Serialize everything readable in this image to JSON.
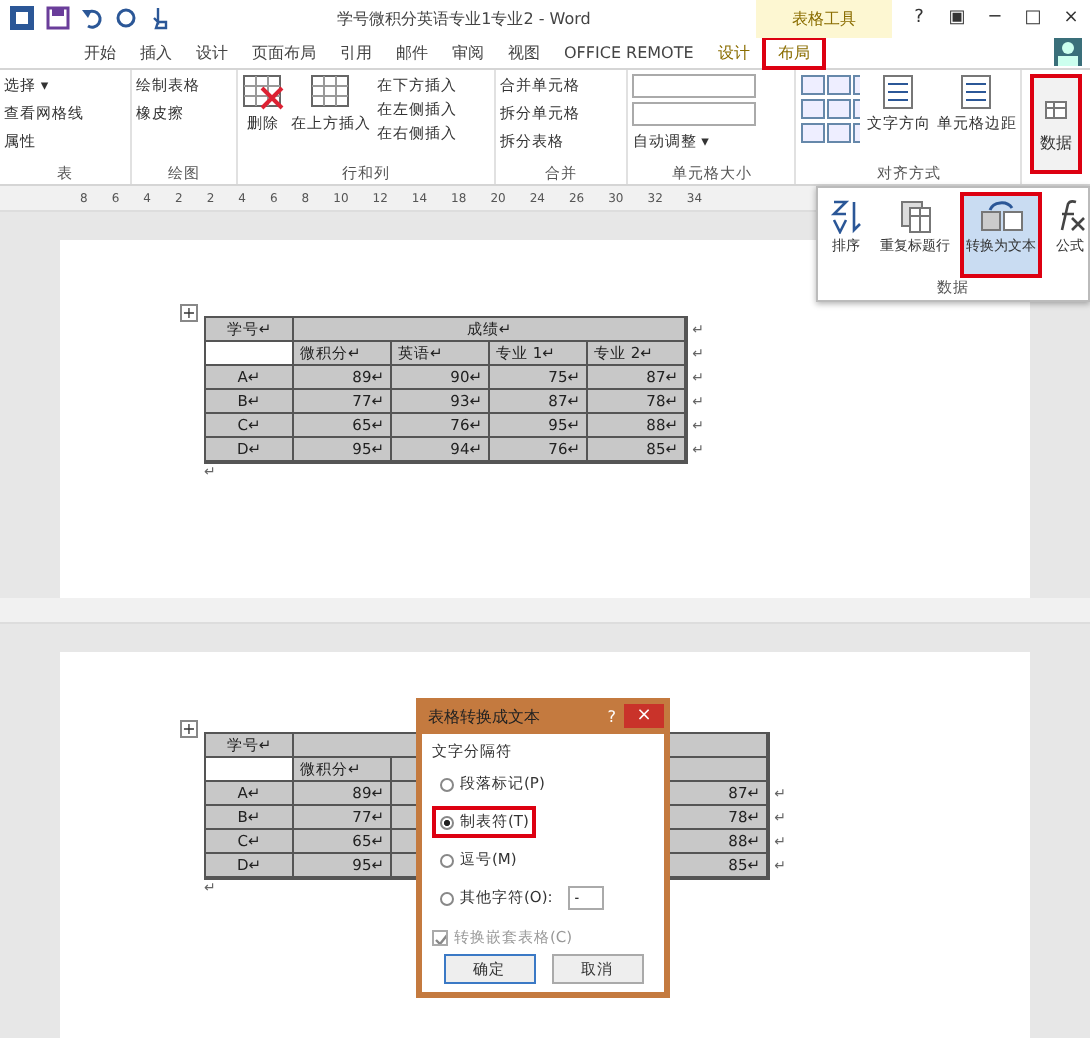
{
  "window": {
    "title": "学号微积分英语专业1专业2 - Word",
    "context_tab_group": "表格工具",
    "controls": [
      "?",
      "▣",
      "─",
      "□",
      "×"
    ]
  },
  "tabs": [
    {
      "label": "开始",
      "selected": false
    },
    {
      "label": "插入",
      "selected": false
    },
    {
      "label": "设计",
      "selected": false
    },
    {
      "label": "页面布局",
      "selected": false
    },
    {
      "label": "引用",
      "selected": false
    },
    {
      "label": "邮件",
      "selected": false
    },
    {
      "label": "审阅",
      "selected": false
    },
    {
      "label": "视图",
      "selected": false
    },
    {
      "label": "OFFICE REMOTE",
      "selected": false
    },
    {
      "label": "设计",
      "selected": false
    },
    {
      "label": "布局",
      "selected": true
    }
  ],
  "ribbon": {
    "groups": [
      {
        "label": "表",
        "items": [
          "选择 ▾",
          "查看网格线",
          "属性"
        ]
      },
      {
        "label": "绘图",
        "items": [
          "绘制表格",
          "橡皮擦"
        ]
      },
      {
        "label": "行和列",
        "big": [
          "删除",
          "在上方插入"
        ],
        "items": [
          "在下方插入",
          "在左侧插入",
          "在右侧插入"
        ]
      },
      {
        "label": "合并",
        "items": [
          "合并单元格",
          "拆分单元格",
          "拆分表格"
        ]
      },
      {
        "label": "单元格大小",
        "items": [
          "自动调整 ▾"
        ]
      },
      {
        "label": "对齐方式",
        "big": [
          "文字方向",
          "单元格边距"
        ]
      }
    ],
    "data_button": {
      "label": "数据",
      "selected": true
    },
    "data_popup": {
      "label": "数据",
      "items": [
        {
          "label": "排序",
          "selected": false
        },
        {
          "label": "重复标题行",
          "selected": false
        },
        {
          "label": "转换为文本",
          "selected": true
        },
        {
          "label": "公式",
          "selected": false
        }
      ]
    }
  },
  "ruler": {
    "labels": [
      "8",
      "6",
      "4",
      "2",
      "2",
      "4",
      "6",
      "8",
      "10",
      "12",
      "14",
      "18",
      "20",
      "24",
      "26",
      "30",
      "32",
      "34"
    ]
  },
  "table": {
    "header": [
      "学号↵",
      "成绩↵"
    ],
    "subheader": [
      "微积分↵",
      "英语↵",
      "专业 1↵",
      "专业 2↵"
    ],
    "rows": [
      [
        "A↵",
        "89↵",
        "90↵",
        "75↵",
        "87↵"
      ],
      [
        "B↵",
        "77↵",
        "93↵",
        "87↵",
        "78↵"
      ],
      [
        "C↵",
        "65↵",
        "76↵",
        "95↵",
        "88↵"
      ],
      [
        "D↵",
        "95↵",
        "94↵",
        "76↵",
        "85↵"
      ]
    ],
    "row_mark": "↵",
    "after_mark": "↵",
    "move_handle": "+"
  },
  "table_2": {
    "header": "学号↵",
    "subheader": "微积分↵",
    "move_handle": "+",
    "rows": [
      [
        "A↵",
        "89↵",
        "87↵"
      ],
      [
        "B↵",
        "77↵",
        "78↵"
      ],
      [
        "C↵",
        "65↵",
        "88↵"
      ],
      [
        "D↵",
        "95↵",
        "85↵"
      ]
    ],
    "row_mark": "↵",
    "after_mark": "↵"
  },
  "dialog": {
    "title": "表格转换成文本",
    "help": "?",
    "close": "×",
    "group": "文字分隔符",
    "options": [
      {
        "label": "段落标记(P)",
        "selected": false
      },
      {
        "label": "制表符(T)",
        "selected": true
      },
      {
        "label": "逗号(M)",
        "selected": false
      },
      {
        "label": "其他字符(O):",
        "selected": false
      }
    ],
    "other_value": "-",
    "nested": {
      "label": "转换嵌套表格(C)",
      "checked": true,
      "disabled": true
    },
    "buttons": [
      "确定",
      "取消"
    ]
  }
}
